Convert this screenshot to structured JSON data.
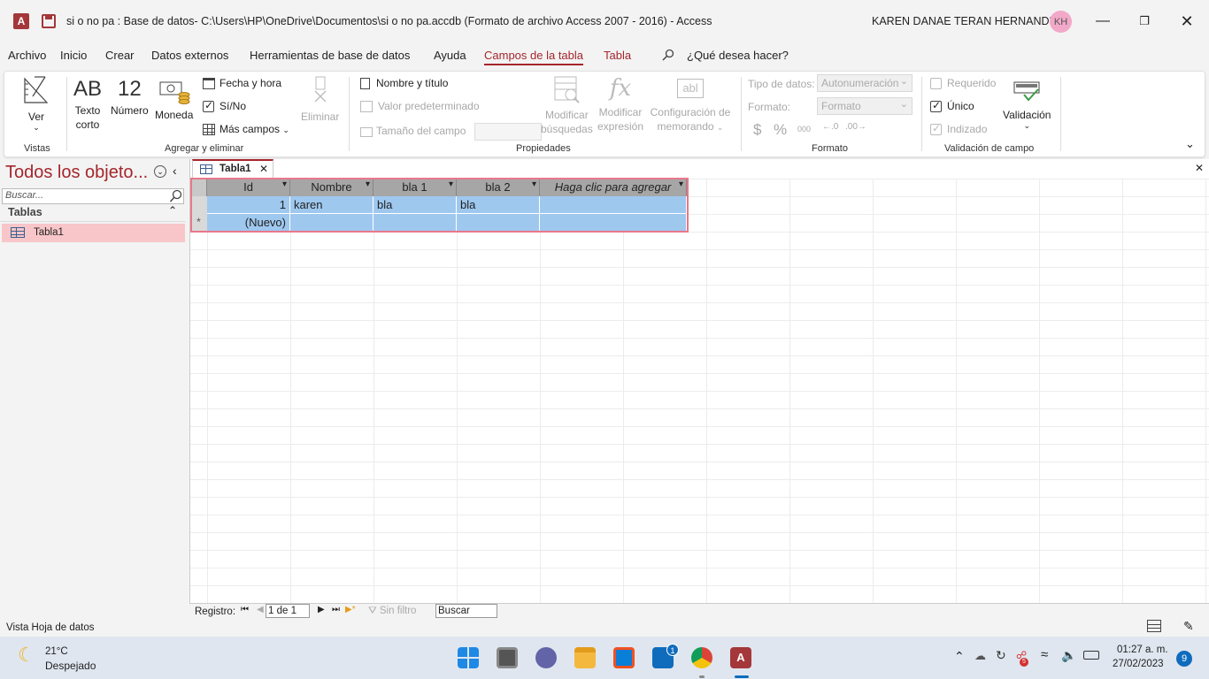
{
  "titlebar": {
    "title": "si o no pa : Base de datos- C:\\Users\\HP\\OneDrive\\Documentos\\si o no pa.accdb (Formato de archivo Access 2007 - 2016)  -  Access",
    "user_name": "KAREN DANAE TERAN HERNANDEZ",
    "avatar_initials": "KH",
    "app_icon_letter": "A"
  },
  "menu": {
    "items": [
      "Archivo",
      "Inicio",
      "Crear",
      "Datos externos",
      "Herramientas de base de datos",
      "Ayuda",
      "Campos de la tabla",
      "Tabla"
    ],
    "search_prompt": "¿Qué desea hacer?"
  },
  "ribbon": {
    "views": {
      "ver_label": "Ver",
      "group_label": "Vistas"
    },
    "add_delete": {
      "texto_corto_glyph": "AB",
      "texto_corto_label1": "Texto",
      "texto_corto_label2": "corto",
      "numero_glyph": "12",
      "numero_label": "Número",
      "moneda_label": "Moneda",
      "fecha_hora": "Fecha y hora",
      "si_no": "Sí/No",
      "mas_campos": "Más campos",
      "eliminar": "Eliminar",
      "group_label": "Agregar y eliminar"
    },
    "properties": {
      "nombre_titulo": "Nombre y título",
      "valor_predeterminado": "Valor predeterminado",
      "tamano_campo": "Tamaño del campo",
      "mod_busquedas_1": "Modificar",
      "mod_busquedas_2": "búsquedas",
      "mod_expresion_1": "Modificar",
      "mod_expresion_2": "expresión",
      "config_memo_1": "Configuración de",
      "config_memo_2": "memorando",
      "fx_glyph": "fx",
      "abl_glyph": "abl",
      "group_label": "Propiedades"
    },
    "format": {
      "tipo_datos_label": "Tipo de datos:",
      "tipo_datos_value": "Autonumeración",
      "formato_label": "Formato:",
      "formato_value": "Formato",
      "currency_glyph": "$",
      "percent_glyph": "%",
      "thousands_glyph": "000",
      "group_label": "Formato"
    },
    "validation": {
      "requerido": "Requerido",
      "unico": "Único",
      "indizado": "Indizado",
      "validacion": "Validación",
      "group_label": "Validación de campo"
    }
  },
  "navpane": {
    "title": "Todos los objeto...",
    "search_placeholder": "Buscar...",
    "section": "Tablas",
    "items": [
      "Tabla1"
    ]
  },
  "document": {
    "tab_label": "Tabla1",
    "columns": [
      "Id",
      "Nombre",
      "bla 1",
      "bla 2",
      "Haga clic para agregar"
    ],
    "rows": [
      [
        "1",
        "karen",
        "bla",
        "bla",
        ""
      ]
    ],
    "new_row_label": "(Nuevo)",
    "new_row_marker": "*"
  },
  "record_nav": {
    "label": "Registro:",
    "position": "1 de 1",
    "filter": "Sin filtro",
    "search": "Buscar"
  },
  "status": {
    "text": "Vista Hoja de datos"
  },
  "taskbar": {
    "weather_temp": "21°C",
    "weather_desc": "Despejado",
    "mail_badge": "1",
    "time": "01:27 a. m.",
    "date": "27/02/2023",
    "notif_count": "9",
    "tray_badge": "5"
  },
  "colors": {
    "accent": "#a4262c",
    "selection": "#9fc8ef",
    "header": "#a6a6a6",
    "nav_selected": "#f8c6c9"
  }
}
